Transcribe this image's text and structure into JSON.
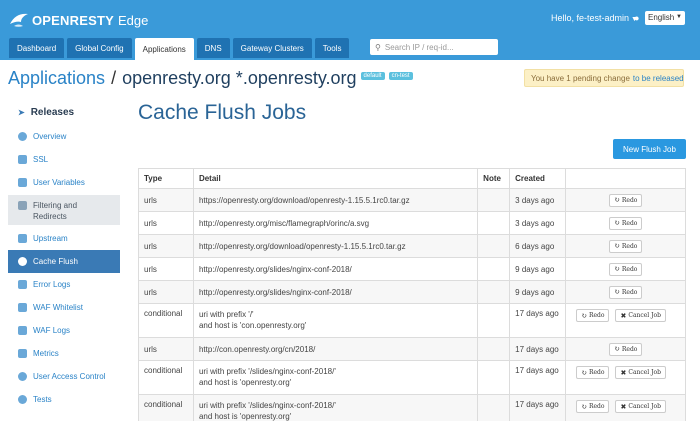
{
  "header": {
    "brand": "OPENRESTY",
    "product": "Edge",
    "greeting": "Hello, fe-test-admin",
    "language": "English",
    "search_placeholder": "Search IP / req-id..."
  },
  "nav": {
    "tabs": [
      {
        "label": "Dashboard"
      },
      {
        "label": "Global Config"
      },
      {
        "label": "Applications"
      },
      {
        "label": "DNS"
      },
      {
        "label": "Gateway Clusters"
      },
      {
        "label": "Tools"
      }
    ]
  },
  "breadcrumb": {
    "root": "Applications",
    "separator": "/",
    "app": "openresty.org *.openresty.org",
    "tags": [
      "default",
      "cn-test"
    ]
  },
  "pending": {
    "text": "You have 1 pending change",
    "link": "to be released"
  },
  "sidebar": {
    "title": "Releases",
    "items": [
      {
        "label": "Overview"
      },
      {
        "label": "SSL"
      },
      {
        "label": "User Variables"
      },
      {
        "label_line1": "Filtering and",
        "label_line2": "Redirects"
      },
      {
        "label": "Upstream"
      },
      {
        "label": "Cache Flush"
      },
      {
        "label": "Error Logs"
      },
      {
        "label": "WAF Whitelist"
      },
      {
        "label": "WAF Logs"
      },
      {
        "label": "Metrics"
      },
      {
        "label": "User Access Control"
      },
      {
        "label": "Tests"
      }
    ]
  },
  "main": {
    "title": "Cache Flush Jobs",
    "new_button": "New Flush Job",
    "columns": [
      "Type",
      "Detail",
      "Note",
      "Created",
      ""
    ],
    "redo_label": "Redo",
    "cancel_label": "Cancel Job",
    "rows": [
      {
        "type": "urls",
        "detail": "https://openresty.org/download/openresty-1.15.5.1rc0.tar.gz",
        "created": "3 days ago"
      },
      {
        "type": "urls",
        "detail": "http://openresty.org/misc/flamegraph/orinc/a.svg",
        "created": "3 days ago"
      },
      {
        "type": "urls",
        "detail": "http://openresty.org/download/openresty-1.15.5.1rc0.tar.gz",
        "created": "6 days ago"
      },
      {
        "type": "urls",
        "detail": "http://openresty.org/slides/nginx-conf-2018/",
        "created": "9 days ago"
      },
      {
        "type": "urls",
        "detail": "http://openresty.org/slides/nginx-conf-2018/",
        "created": "9 days ago"
      },
      {
        "type": "conditional",
        "detail_line1": "uri with prefix '/'",
        "detail_line2": "and host is 'con.openresty.org'",
        "created": "17 days ago"
      },
      {
        "type": "urls",
        "detail": "http://con.openresty.org/cn/2018/",
        "created": "17 days ago"
      },
      {
        "type": "conditional",
        "detail_line1": "uri with prefix '/slides/nginx-conf-2018/'",
        "detail_line2": "and host is 'openresty.org'",
        "created": "17 days ago"
      },
      {
        "type": "conditional",
        "detail_line1": "uri with prefix '/slides/nginx-conf-2018/'",
        "detail_line2": "and host is 'openresty.org'",
        "created": "17 days ago"
      }
    ]
  }
}
